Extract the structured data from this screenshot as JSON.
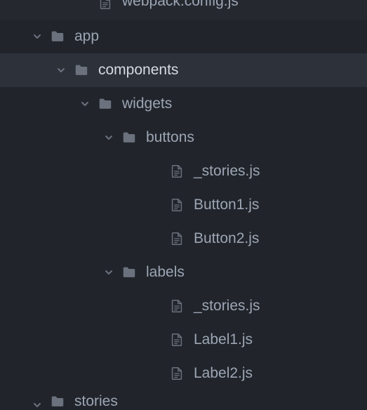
{
  "colors": {
    "bg": "#21252b",
    "selected_bg": "#2c313a",
    "text": "#9da5b4",
    "text_selected": "#d7dae0",
    "icon": "#6b717d"
  },
  "tree": [
    {
      "label": "webpack.config.js",
      "type": "file",
      "depth": 0,
      "expanded": false,
      "selected": false,
      "partial": "top"
    },
    {
      "label": "app",
      "type": "folder",
      "depth": 1,
      "expanded": true,
      "selected": false
    },
    {
      "label": "components",
      "type": "folder",
      "depth": 2,
      "expanded": true,
      "selected": true
    },
    {
      "label": "widgets",
      "type": "folder",
      "depth": 3,
      "expanded": true,
      "selected": false
    },
    {
      "label": "buttons",
      "type": "folder",
      "depth": 4,
      "expanded": true,
      "selected": false
    },
    {
      "label": "_stories.js",
      "type": "file",
      "depth": 5,
      "expanded": false,
      "selected": false
    },
    {
      "label": "Button1.js",
      "type": "file",
      "depth": 5,
      "expanded": false,
      "selected": false
    },
    {
      "label": "Button2.js",
      "type": "file",
      "depth": 5,
      "expanded": false,
      "selected": false
    },
    {
      "label": "labels",
      "type": "folder",
      "depth": 4,
      "expanded": true,
      "selected": false
    },
    {
      "label": "_stories.js",
      "type": "file",
      "depth": 5,
      "expanded": false,
      "selected": false
    },
    {
      "label": "Label1.js",
      "type": "file",
      "depth": 5,
      "expanded": false,
      "selected": false
    },
    {
      "label": "Label2.js",
      "type": "file",
      "depth": 5,
      "expanded": false,
      "selected": false
    },
    {
      "label": "stories",
      "type": "folder",
      "depth": 1,
      "expanded": true,
      "selected": false,
      "partial": "bottom"
    }
  ]
}
